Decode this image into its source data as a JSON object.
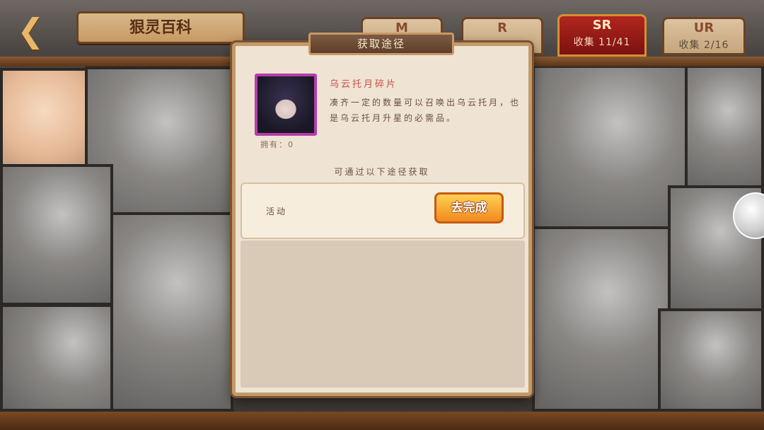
{
  "header": {
    "back_icon": "back-arrow-icon",
    "title": "狠灵百科"
  },
  "tabs": [
    {
      "label": "M",
      "count": ""
    },
    {
      "label": "R",
      "count": ""
    },
    {
      "label": "SR",
      "count": "收集  11/41",
      "active": true
    },
    {
      "label": "UR",
      "count": "收集  2/16"
    }
  ],
  "modal": {
    "title": "获取途径",
    "item": {
      "name": "乌云托月碎片",
      "description": "凑齐一定的数量可以召唤出乌云托月，也是乌云托月升星的必需品。",
      "owned": "拥有：0"
    },
    "obtain_heading": "可通过以下途径获取",
    "sources": [
      {
        "label": "活动",
        "button": "去完成"
      }
    ]
  },
  "colors": {
    "accent": "#f08b1e",
    "active_tab": "#a11d18",
    "item_frame": "#b43ea8"
  }
}
